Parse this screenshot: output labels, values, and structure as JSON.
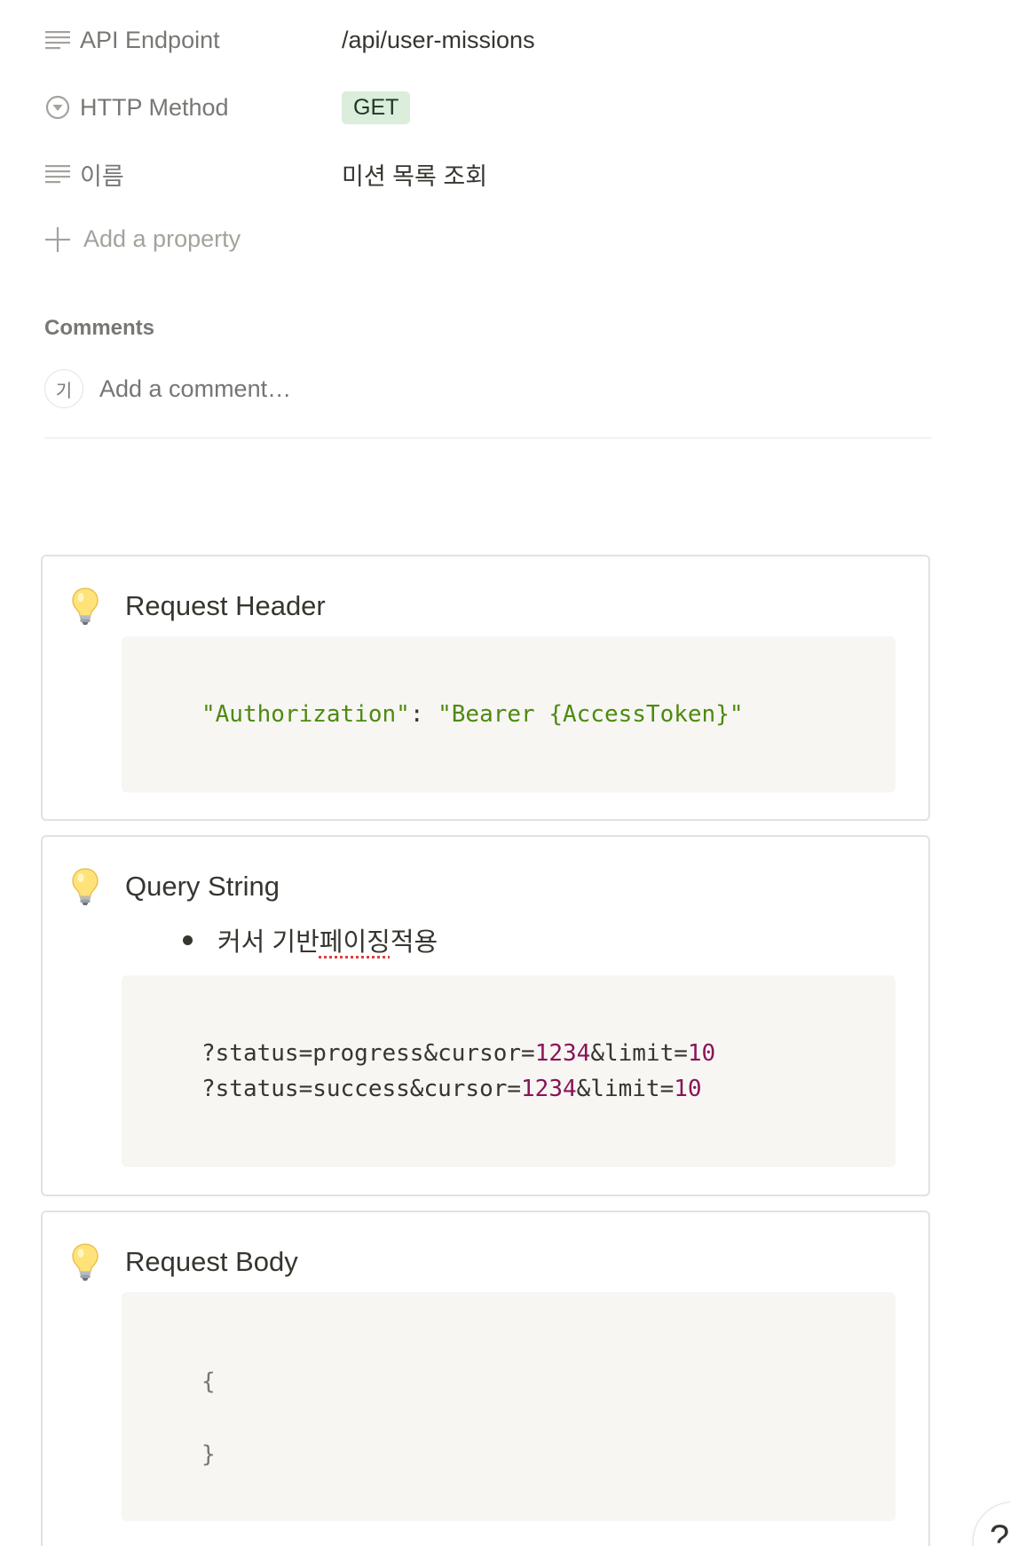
{
  "properties": [
    {
      "icon": "text-lines-icon",
      "label": "API Endpoint",
      "value": "/api/user-missions"
    },
    {
      "icon": "select-circle-icon",
      "label": "HTTP Method",
      "value": "GET"
    },
    {
      "icon": "text-lines-icon",
      "label": "이름",
      "value": "미션 목록 조회"
    }
  ],
  "add_property_label": "Add a property",
  "comments": {
    "title": "Comments",
    "avatar_initial": "기",
    "placeholder": "Add a comment…"
  },
  "callouts": {
    "header": {
      "icon": "lightbulb-icon",
      "title": "Request Header",
      "code_key": "\"Authorization\"",
      "code_colon": ":",
      "code_value": "\"Bearer {AccessToken}\""
    },
    "query": {
      "icon": "lightbulb-icon",
      "title": "Query String",
      "bullet_prefix": "커서 기반 ",
      "bullet_spell": "페이징",
      "bullet_suffix": " 적용",
      "line1_a": "?status=progress&cursor=",
      "line1_num1": "1234",
      "line1_b": "&limit=",
      "line1_num2": "10",
      "line2_a": "?status=success&cursor=",
      "line2_num1": "1234",
      "line2_b": "&limit=",
      "line2_num2": "10"
    },
    "body": {
      "icon": "lightbulb-icon",
      "title": "Request Body",
      "open_brace": "{",
      "close_brace": "}"
    }
  },
  "help_label": "?"
}
